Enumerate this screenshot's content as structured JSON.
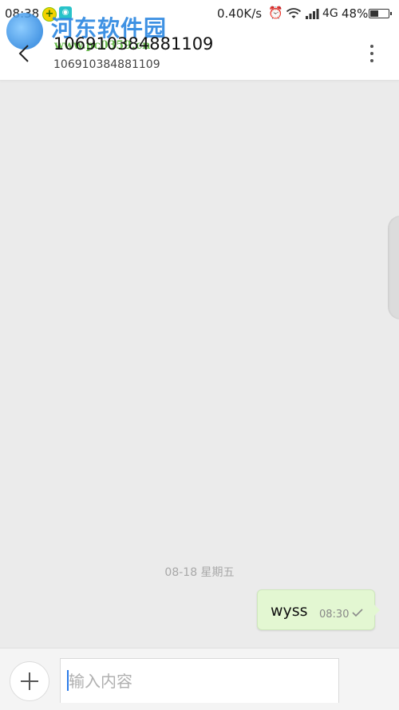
{
  "status_bar": {
    "time": "08:38",
    "network_speed": "0.40K/s",
    "network_type": "4G",
    "battery_percent": "48%",
    "battery_level": 0.48,
    "icons": [
      "notification-app-icon",
      "notification-app2-icon",
      "alarm-icon",
      "wifi-icon",
      "signal-icon",
      "battery-icon"
    ]
  },
  "watermark": {
    "title": "河东软件园",
    "url": "www.pc0359.cn"
  },
  "header": {
    "title": "106910384881109",
    "subtitle": "106910384881109",
    "back_icon": "back-chevron-icon",
    "more_icon": "more-vertical-icon"
  },
  "conversation": {
    "date_separator": "08-18  星期五",
    "messages": [
      {
        "text": "wyss",
        "time": "08:30",
        "status_icon": "sent-check-icon",
        "outgoing": true
      }
    ]
  },
  "composer": {
    "placeholder": "输入内容",
    "value": "",
    "add_icon": "plus-icon"
  },
  "colors": {
    "background": "#ebebeb",
    "bubble_outgoing": "#e3f7d2",
    "accent": "#2b7be8"
  }
}
